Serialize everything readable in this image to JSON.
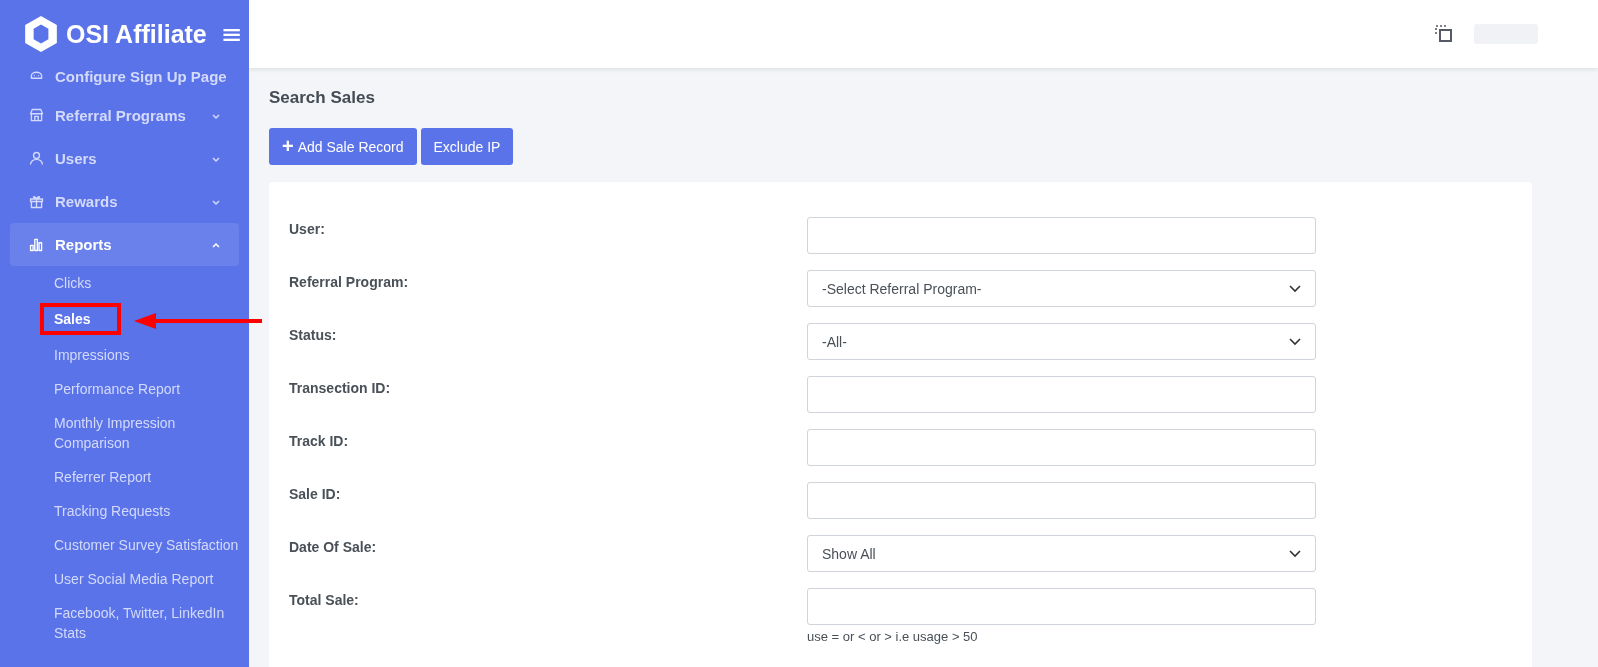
{
  "brand": {
    "name": "OSI Affiliate",
    "menu_icon": "≡"
  },
  "sidebar": {
    "items": [
      {
        "label": "Configure Sign Up Page",
        "kind": "link",
        "selected": false
      },
      {
        "label": "Referral Programs",
        "kind": "menu",
        "expanded": false,
        "selected": false
      },
      {
        "label": "Users",
        "kind": "menu",
        "expanded": false,
        "selected": false
      },
      {
        "label": "Rewards",
        "kind": "menu",
        "expanded": false,
        "selected": false
      },
      {
        "label": "Reports",
        "kind": "menu",
        "expanded": true,
        "selected": true,
        "children": [
          {
            "label": "Clicks",
            "selected": false,
            "annotated": false
          },
          {
            "label": "Sales",
            "selected": true,
            "annotated": true
          },
          {
            "label": "Impressions",
            "selected": false,
            "annotated": false
          },
          {
            "label": "Performance Report",
            "selected": false,
            "annotated": false
          },
          {
            "label": "Monthly Impression Comparison",
            "selected": false,
            "annotated": false
          },
          {
            "label": "Referrer Report",
            "selected": false,
            "annotated": false
          },
          {
            "label": "Tracking Requests",
            "selected": false,
            "annotated": false
          },
          {
            "label": "Customer Survey Satisfaction",
            "selected": false,
            "annotated": false
          },
          {
            "label": "User Social Media Report",
            "selected": false,
            "annotated": false
          },
          {
            "label": "Facebook, Twitter, LinkedIn Stats",
            "selected": false,
            "annotated": false
          }
        ]
      }
    ]
  },
  "page": {
    "title": "Search Sales",
    "buttons": [
      {
        "label": "Add Sale Record",
        "icon": "+"
      },
      {
        "label": "Exclude IP"
      }
    ],
    "fields": [
      {
        "label": "User:",
        "kind": "text"
      },
      {
        "label": "Referral Program:",
        "kind": "select",
        "value": "-Select Referral Program-"
      },
      {
        "label": "Status:",
        "kind": "select",
        "value": "-All-"
      },
      {
        "label": "Transection ID:",
        "kind": "text"
      },
      {
        "label": "Track ID:",
        "kind": "text"
      },
      {
        "label": "Sale ID:",
        "kind": "text"
      },
      {
        "label": "Date Of Sale:",
        "kind": "select",
        "value": "Show All"
      },
      {
        "label": "Total Sale:",
        "kind": "text",
        "hint": "use = or < or > i.e usage > 50"
      }
    ]
  }
}
